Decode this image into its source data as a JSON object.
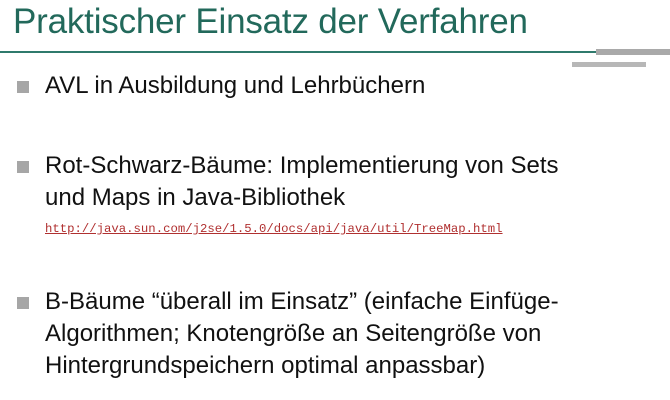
{
  "slide": {
    "title": "Praktischer Einsatz der Verfahren",
    "bullets": [
      {
        "lines": [
          "AVL in Ausbildung und Lehrbüchern"
        ]
      },
      {
        "lines": [
          "Rot-Schwarz-Bäume: Implementierung von Sets",
          "und Maps in Java-Bibliothek"
        ],
        "link": "http://java.sun.com/j2se/1.5.0/docs/api/java/util/TreeMap.html"
      },
      {
        "lines": [
          "B-Bäume “überall im Einsatz” (einfache Einfüge-",
          "Algorithmen; Knotengröße an Seitengröße von",
          "Hintergrundspeichern optimal anpassbar)"
        ]
      }
    ]
  },
  "colors": {
    "title": "#22695b",
    "rule": "#2f7a6c",
    "bullet_marker": "#a6a6a6",
    "link": "#b03030"
  }
}
